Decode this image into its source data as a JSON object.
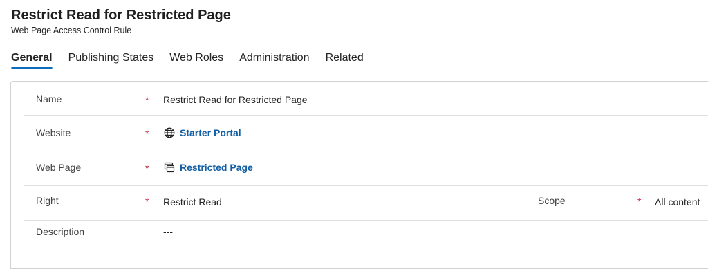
{
  "header": {
    "title": "Restrict Read for Restricted Page",
    "subtitle": "Web Page Access Control Rule"
  },
  "tabs": [
    {
      "label": "General",
      "active": true
    },
    {
      "label": "Publishing States",
      "active": false
    },
    {
      "label": "Web Roles",
      "active": false
    },
    {
      "label": "Administration",
      "active": false
    },
    {
      "label": "Related",
      "active": false
    }
  ],
  "form": {
    "name": {
      "label": "Name",
      "required_mark": "*",
      "value": "Restrict Read for Restricted Page"
    },
    "website": {
      "label": "Website",
      "required_mark": "*",
      "value": "Starter Portal",
      "icon": "globe-icon"
    },
    "web_page": {
      "label": "Web Page",
      "required_mark": "*",
      "value": "Restricted Page",
      "icon": "web-page-icon"
    },
    "right": {
      "label": "Right",
      "required_mark": "*",
      "value": "Restrict Read"
    },
    "scope": {
      "label": "Scope",
      "required_mark": "*",
      "value": "All content"
    },
    "description": {
      "label": "Description",
      "value": "---"
    }
  },
  "colors": {
    "accent": "#0f6cbd",
    "link": "#115ea3",
    "required": "#c4314b"
  }
}
